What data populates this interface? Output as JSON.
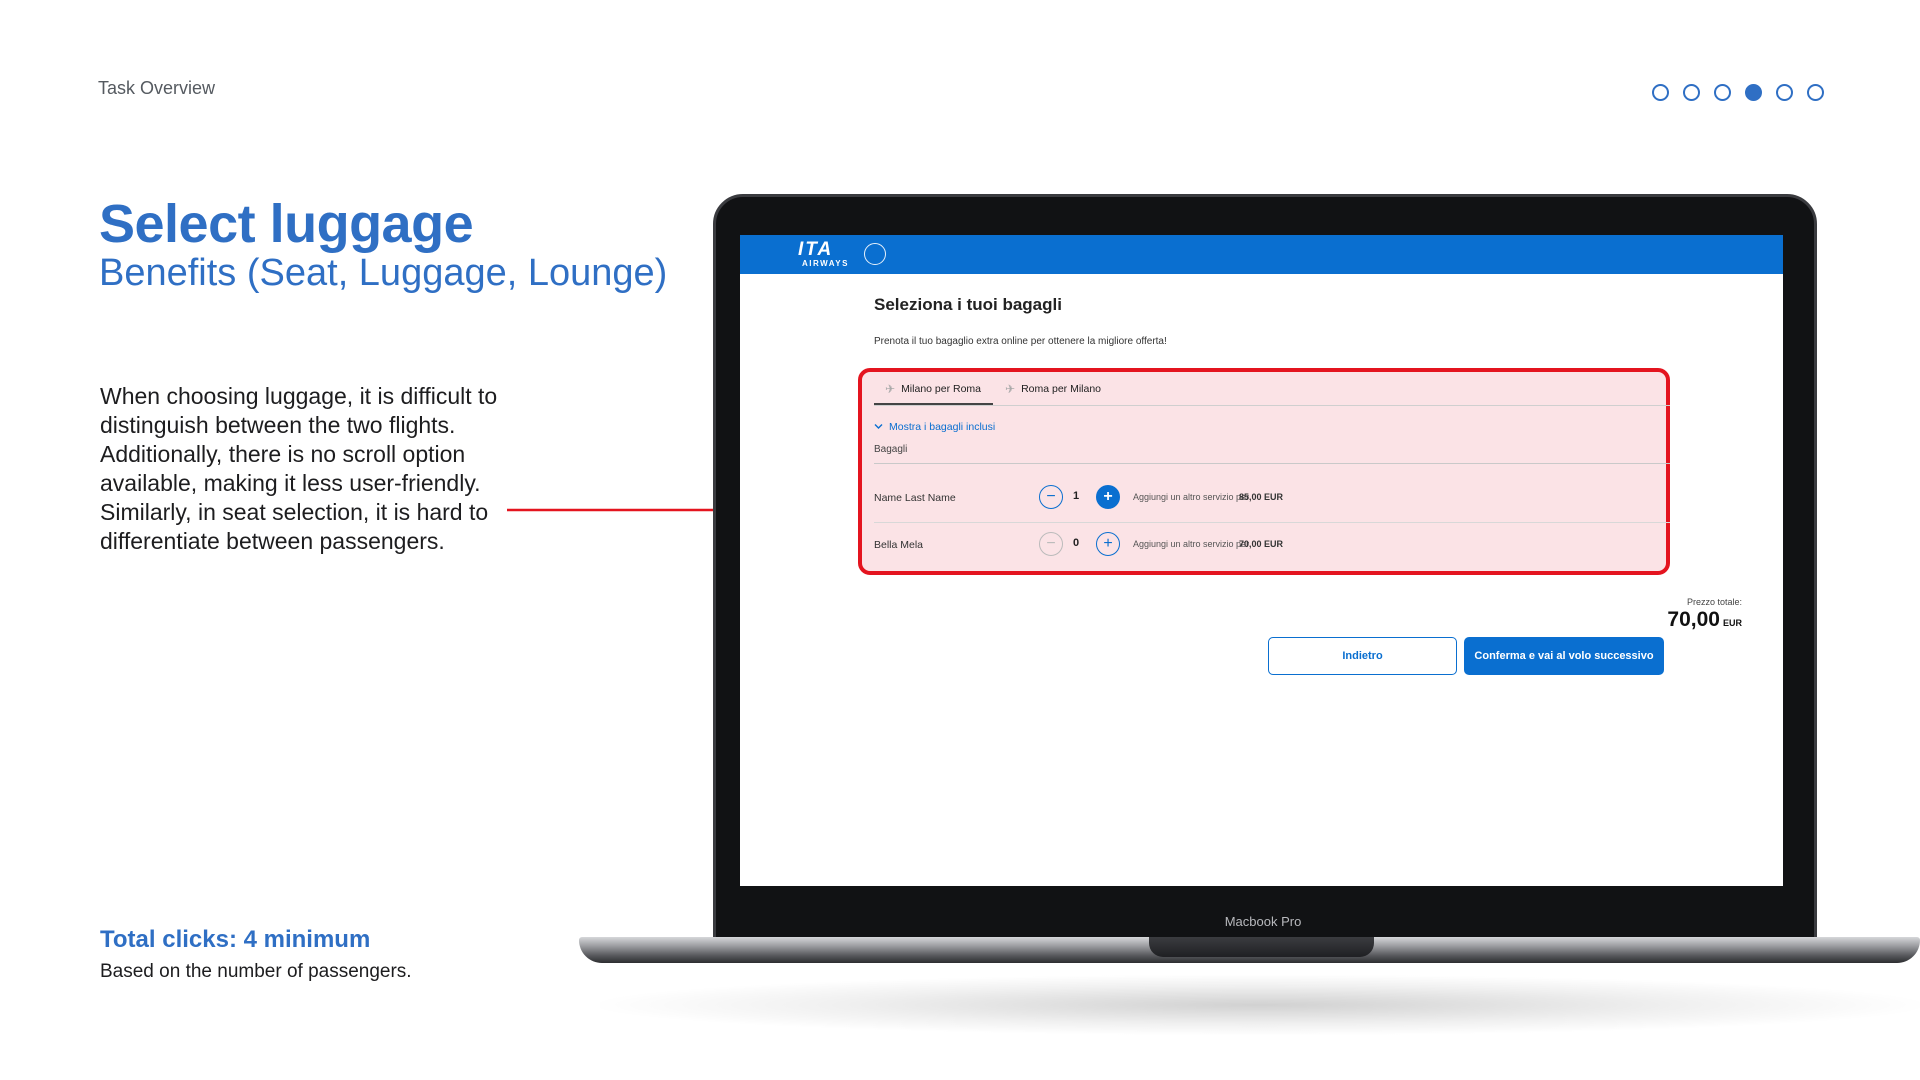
{
  "slide": {
    "header_label": "Task Overview",
    "pager_total": 6,
    "pager_active_index": 3,
    "title": "Select luggage",
    "subtitle": "Benefits (Seat, Luggage, Lounge)",
    "description": "When choosing luggage, it is difficult to distinguish between the two flights. Additionally, there is no scroll option available, making it less user-friendly. Similarly, in seat selection, it is hard to differentiate between passengers.",
    "clicks_title": "Total clicks: 4 minimum",
    "clicks_note": "Based on the number of passengers.",
    "highlight_color": "#e4141f",
    "accent_color": "#2f6fc4"
  },
  "laptop": {
    "label": "Macbook Pro"
  },
  "app": {
    "brand": {
      "name": "ITA",
      "sub": "AIRWAYS",
      "color": "#0a6fd0"
    },
    "page_title": "Seleziona i tuoi bagagli",
    "page_subtitle": "Prenota il tuo bagaglio extra online per ottenere la migliore offerta!",
    "tabs": [
      {
        "label": "Milano per Roma",
        "active": true,
        "icon": "plane-icon"
      },
      {
        "label": "Roma per Milano",
        "active": false,
        "icon": "plane-icon"
      }
    ],
    "show_included": "Mostra i bagagli inclusi",
    "bags_label": "Bagagli",
    "passengers": [
      {
        "name": "Name Last Name",
        "quantity": "1",
        "add_text": "Aggiungi un altro servizio per",
        "price": "85,00  EUR"
      },
      {
        "name": "Bella Mela",
        "quantity": "0",
        "add_text": "Aggiungi un altro servizio per",
        "price": "70,00  EUR"
      }
    ],
    "total_label": "Prezzo totale:",
    "total_value": "70,00",
    "total_currency": "EUR",
    "back_label": "Indietro",
    "confirm_label": "Conferma e vai al volo successivo"
  }
}
